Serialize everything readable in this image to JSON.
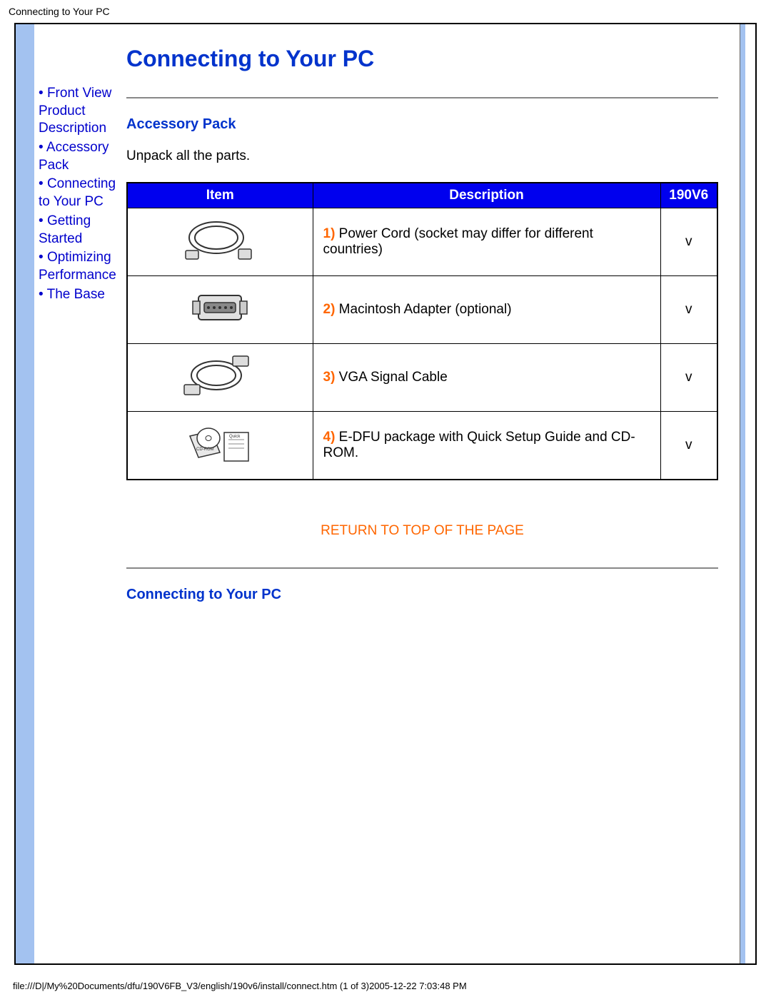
{
  "header": {
    "title": "Connecting to Your PC"
  },
  "sidebar": {
    "items": [
      {
        "label": "Front View Product Description"
      },
      {
        "label": "Accessory Pack"
      },
      {
        "label": "Connecting to Your PC"
      },
      {
        "label": "Getting Started"
      },
      {
        "label": "Optimizing Performance"
      },
      {
        "label": "The Base"
      }
    ]
  },
  "main": {
    "page_title": "Connecting to Your PC",
    "section1_heading": "Accessory Pack",
    "section1_body": "Unpack all the parts.",
    "table": {
      "headers": {
        "item": "Item",
        "description": "Description",
        "model": "190V6"
      },
      "rows": [
        {
          "num": "1)",
          "desc": " Power Cord (socket may differ for different countries)",
          "check": "v"
        },
        {
          "num": "2)",
          "desc": " Macintosh Adapter (optional)",
          "check": "v"
        },
        {
          "num": "3)",
          "desc": " VGA Signal Cable",
          "check": "v"
        },
        {
          "num": "4)",
          "desc": " E-DFU package with Quick Setup Guide and CD-ROM.",
          "check": "v"
        }
      ]
    },
    "return_link": "RETURN TO TOP OF THE PAGE",
    "section2_heading": "Connecting to Your PC"
  },
  "footer": {
    "path": "file:///D|/My%20Documents/dfu/190V6FB_V3/english/190v6/install/connect.htm (1 of 3)2005-12-22 7:03:48 PM"
  }
}
